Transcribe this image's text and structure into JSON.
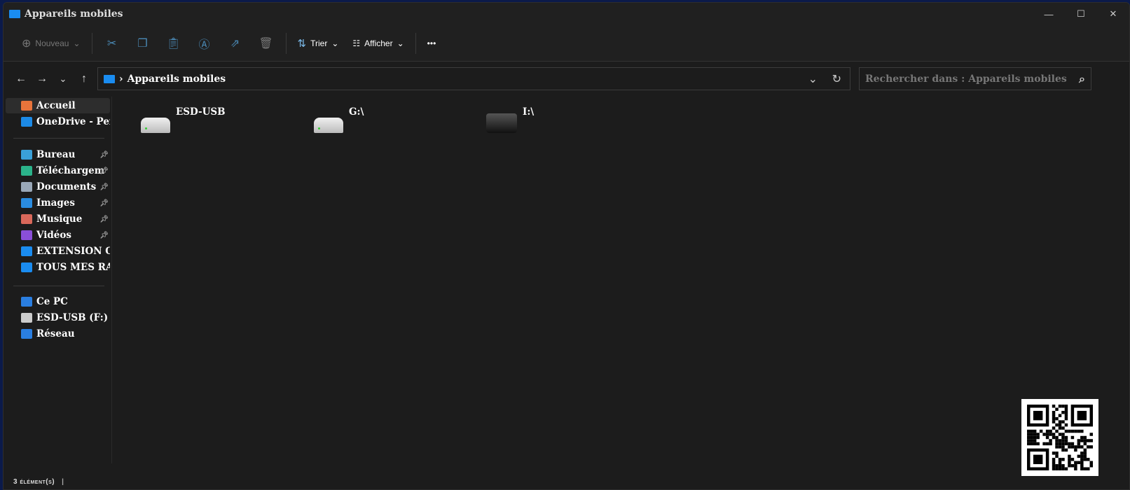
{
  "window": {
    "title": "Appareils mobiles",
    "controls": [
      "—",
      "☐",
      "✕"
    ]
  },
  "toolbar": {
    "new_label": "Nouveau",
    "sort_label": "Trier",
    "view_label": "Afficher",
    "more_label": "•••"
  },
  "nav": {
    "back": "←",
    "forward": "→",
    "recent": "⌄",
    "up": "↑"
  },
  "address": {
    "separator": "›",
    "path": "Appareils mobiles",
    "dropdown": "⌄",
    "refresh": "↻"
  },
  "search": {
    "placeholder": "Rechercher dans : Appareils mobiles",
    "icon": "⌕"
  },
  "sidebar": {
    "items": [
      {
        "label": "Accueil",
        "icon": "home-icon",
        "color": "#e8743b"
      },
      {
        "label": "OneDrive - Pers",
        "icon": "onedrive-icon",
        "color": "#1c8ae6"
      },
      {
        "label": "Bureau",
        "icon": "desktop-icon",
        "color": "#3aa0d8",
        "pinned": true
      },
      {
        "label": "Téléchargem",
        "icon": "download-icon",
        "color": "#2bb38a",
        "pinned": true
      },
      {
        "label": "Documents",
        "icon": "documents-icon",
        "color": "#9aa8b8",
        "pinned": true
      },
      {
        "label": "Images",
        "icon": "images-icon",
        "color": "#2a8ce0",
        "pinned": true
      },
      {
        "label": "Musique",
        "icon": "music-icon",
        "color": "#d9685a",
        "pinned": true
      },
      {
        "label": "Vidéos",
        "icon": "videos-icon",
        "color": "#8a4fd8",
        "pinned": true
      },
      {
        "label": "EXTENSION OF",
        "icon": "folder-icon",
        "color": "#1a8cf0"
      },
      {
        "label": "TOUS MES RAC",
        "icon": "folder-icon",
        "color": "#1a8cf0"
      },
      {
        "label": "Ce PC",
        "icon": "pc-icon",
        "color": "#2a7ee0"
      },
      {
        "label": "ESD-USB (F:)",
        "icon": "drive-icon",
        "color": "#ccc"
      },
      {
        "label": "Réseau",
        "icon": "network-icon",
        "color": "#2a7ee0"
      }
    ]
  },
  "content": {
    "items": [
      {
        "label": "ESD-USB",
        "icon": "drive-icon"
      },
      {
        "label": "G:\\",
        "icon": "drive-icon"
      },
      {
        "label": "I:\\",
        "icon": "printer-icon"
      }
    ]
  },
  "status": {
    "count": "3 élément(s)"
  }
}
